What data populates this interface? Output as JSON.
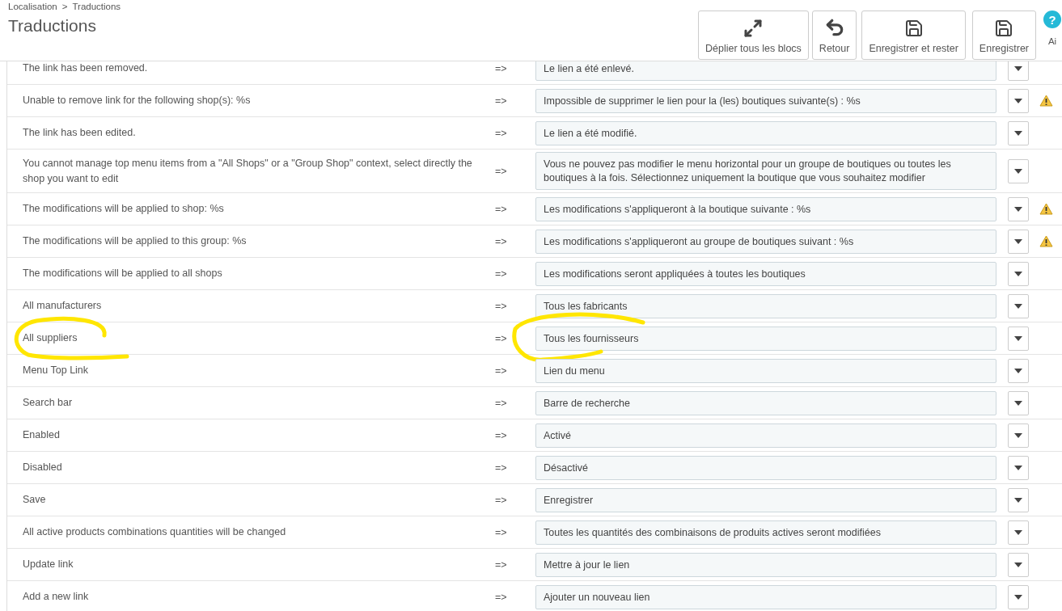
{
  "breadcrumb": [
    "Localisation",
    ">",
    "Traductions"
  ],
  "title": "Traductions",
  "toolbar": [
    {
      "kind": "expand",
      "label": "Déplier tous les blocs"
    },
    {
      "kind": "back",
      "label": "Retour"
    },
    {
      "kind": "save",
      "label": "Enregistrer et rester"
    },
    {
      "kind": "save",
      "label": "Enregistrer"
    }
  ],
  "help": {
    "glyph": "?",
    "label": "Ai"
  },
  "rows": [
    {
      "source": "The link has been removed.",
      "arrow": "=>",
      "translation": "Le lien a été enlevé.",
      "warning": false,
      "circled": false
    },
    {
      "source": "Unable to remove link for the following shop(s): %s",
      "arrow": "=>",
      "translation": "Impossible de supprimer le lien pour la (les) boutiques suivante(s) : %s",
      "warning": true,
      "circled": false
    },
    {
      "source": "The link has been edited.",
      "arrow": "=>",
      "translation": "Le lien a été modifié.",
      "warning": false,
      "circled": false
    },
    {
      "source": "You cannot manage top menu items from a \"All Shops\" or a \"Group Shop\" context, select directly the shop you want to edit",
      "arrow": "=>",
      "translation": "Vous ne pouvez pas modifier le menu horizontal pour un groupe de boutiques ou toutes les boutiques à la fois. Sélectionnez uniquement la boutique que vous souhaitez modifier",
      "warning": false,
      "circled": false
    },
    {
      "source": "The modifications will be applied to shop: %s",
      "arrow": "=>",
      "translation": "Les modifications s'appliqueront à la boutique suivante : %s",
      "warning": true,
      "circled": false
    },
    {
      "source": "The modifications will be applied to this group: %s",
      "arrow": "=>",
      "translation": "Les modifications s'appliqueront au groupe de boutiques suivant : %s",
      "warning": true,
      "circled": false
    },
    {
      "source": "The modifications will be applied to all shops",
      "arrow": "=>",
      "translation": "Les modifications seront appliquées à toutes les boutiques",
      "warning": false,
      "circled": false
    },
    {
      "source": "All manufacturers",
      "arrow": "=>",
      "translation": "Tous les fabricants",
      "warning": false,
      "circled": false
    },
    {
      "source": "All suppliers",
      "arrow": "=>",
      "translation": "Tous les fournisseurs",
      "warning": false,
      "circled": true
    },
    {
      "source": "Menu Top Link",
      "arrow": "=>",
      "translation": "Lien du menu",
      "warning": false,
      "circled": false
    },
    {
      "source": "Search bar",
      "arrow": "=>",
      "translation": "Barre de recherche",
      "warning": false,
      "circled": false
    },
    {
      "source": "Enabled",
      "arrow": "=>",
      "translation": "Activé",
      "warning": false,
      "circled": false
    },
    {
      "source": "Disabled",
      "arrow": "=>",
      "translation": "Désactivé",
      "warning": false,
      "circled": false
    },
    {
      "source": "Save",
      "arrow": "=>",
      "translation": "Enregistrer",
      "warning": false,
      "circled": false
    },
    {
      "source": "All active products combinations quantities will be changed",
      "arrow": "=>",
      "translation": "Toutes les quantités des combinaisons de produits actives seront modifiées",
      "warning": false,
      "circled": false
    },
    {
      "source": "Update link",
      "arrow": "=>",
      "translation": "Mettre à jour le lien",
      "warning": false,
      "circled": false
    },
    {
      "source": "Add a new link",
      "arrow": "=>",
      "translation": "Ajouter un nouveau lien",
      "warning": false,
      "circled": false
    }
  ]
}
